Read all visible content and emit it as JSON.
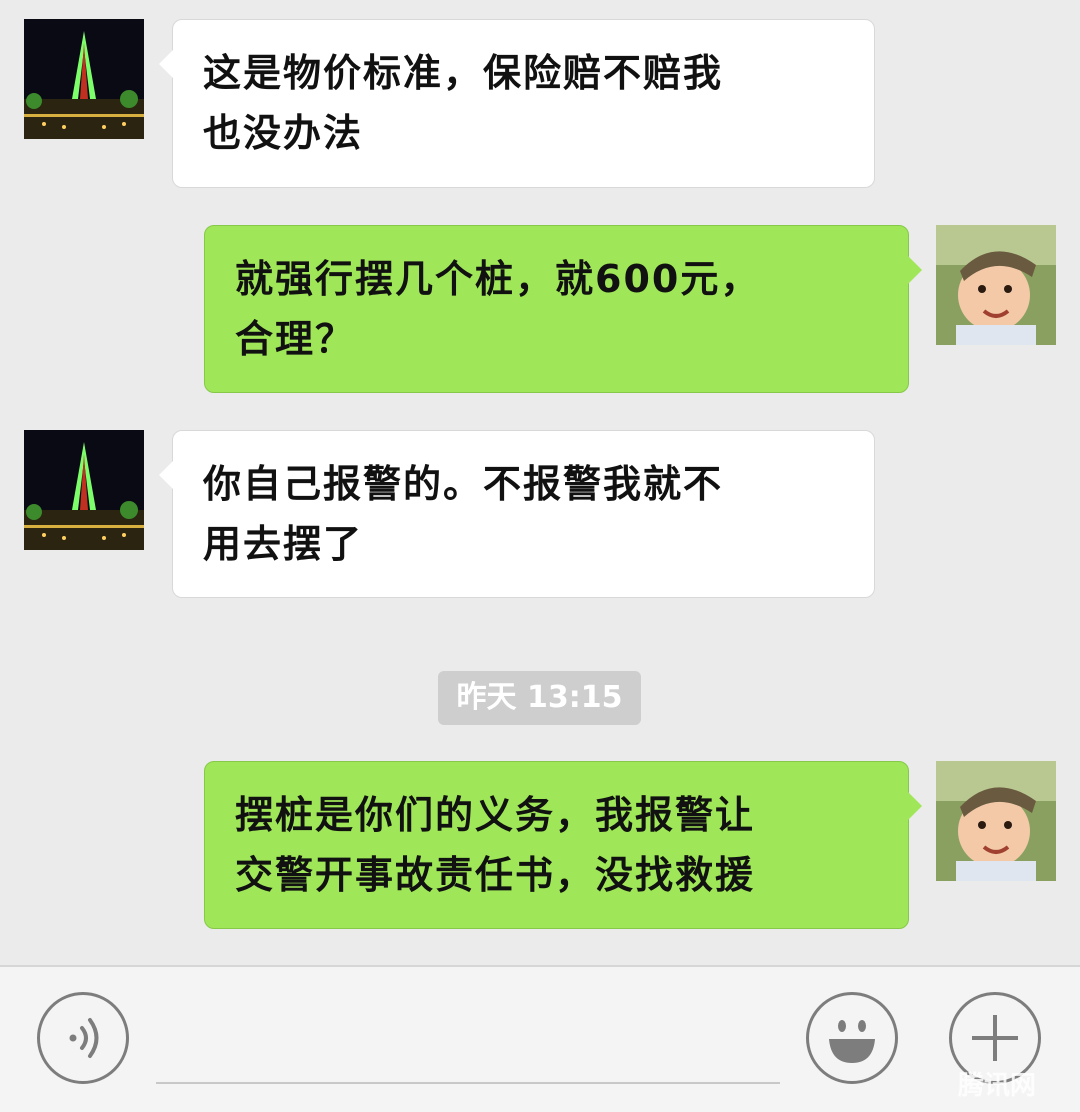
{
  "messages": [
    {
      "side": "in",
      "text_line1": "这是物价标准，保险赔不赔我",
      "text_line2": "也没办法"
    },
    {
      "side": "out",
      "text_line1": "就强行摆几个桩，就600元，",
      "text_line2": "合理？"
    },
    {
      "side": "in",
      "text_line1": "你自己报警的。不报警我就不",
      "text_line2": "用去摆了"
    },
    {
      "side": "out",
      "text_line1": "摆桩是你们的义务，我报警让",
      "text_line2": "交警开事故责任书，没找救援"
    }
  ],
  "timestamp": "昨天 13:15",
  "bottom_bar": {
    "voice_icon": "voice-icon",
    "emoji_icon": "smiley-icon",
    "plus_icon": "plus-icon",
    "input_value": ""
  },
  "watermark": "腾讯网",
  "colors": {
    "background": "#ebebeb",
    "incoming_bubble": "#ffffff",
    "outgoing_bubble": "#9fe658",
    "timestamp_bg": "#cecece"
  }
}
